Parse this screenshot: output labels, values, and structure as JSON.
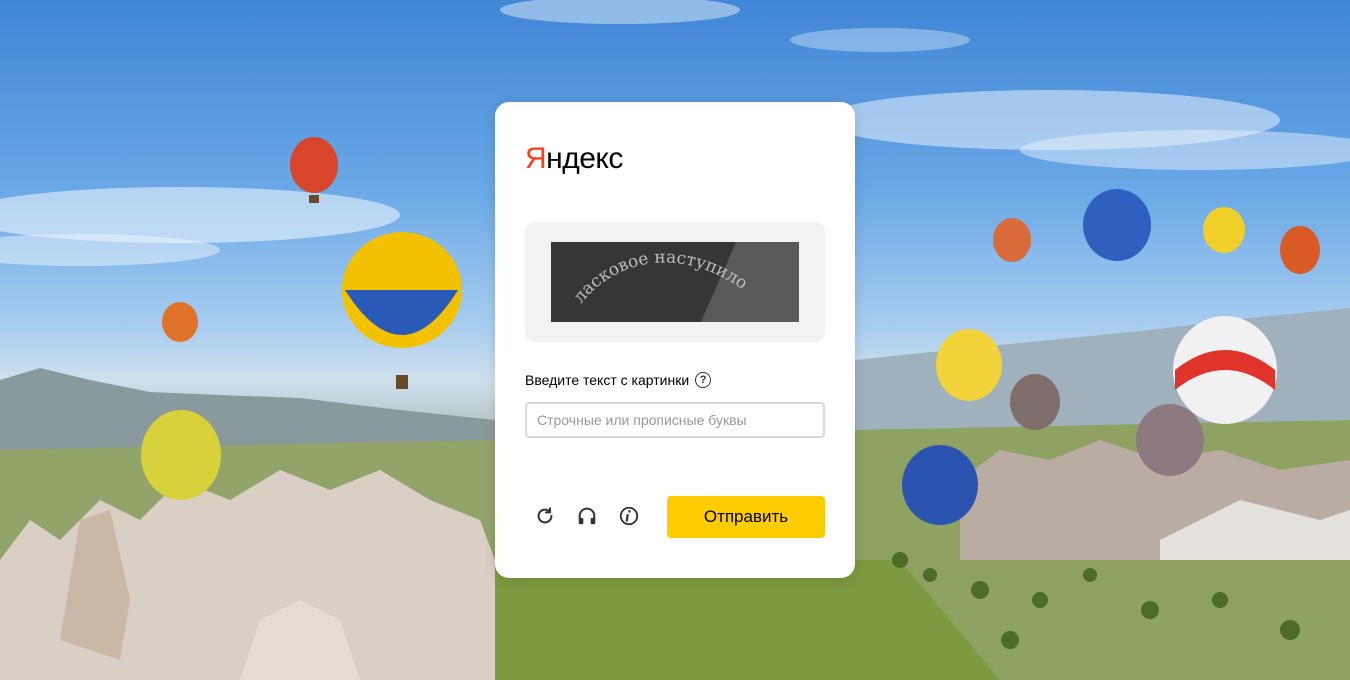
{
  "logo": {
    "first_letter": "Я",
    "rest": "ндекс"
  },
  "captcha": {
    "image_text": "ласковое наступило"
  },
  "prompt": {
    "label": "Введите текст с картинки",
    "help_symbol": "?"
  },
  "input": {
    "placeholder": "Строчные или прописные буквы",
    "value": ""
  },
  "actions": {
    "refresh_icon": "refresh-icon",
    "audio_icon": "headphones-icon",
    "info_icon": "info-icon"
  },
  "submit": {
    "label": "Отправить"
  },
  "colors": {
    "accent_button": "#ffcc00",
    "logo_red": "#fc3f1d",
    "card_bg": "#ffffff"
  }
}
